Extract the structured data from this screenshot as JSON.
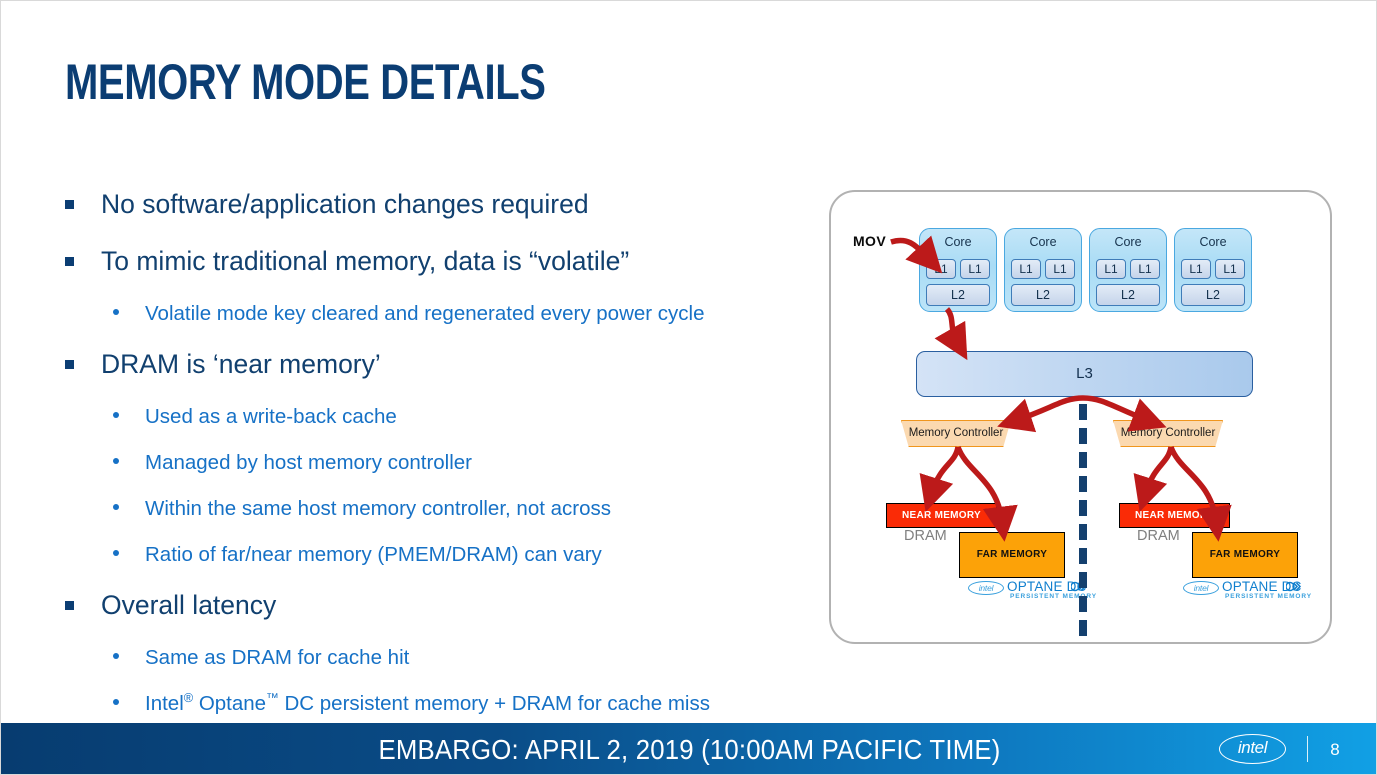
{
  "slide": {
    "title": "MEMORY MODE DETAILS",
    "title_color": "#0b3d73",
    "background": "#ffffff"
  },
  "bullets": [
    {
      "level": 1,
      "text": "No software/application changes required"
    },
    {
      "level": 1,
      "text": "To mimic traditional memory, data is “volatile”"
    },
    {
      "level": 2,
      "text": "Volatile mode key cleared and regenerated every power cycle"
    },
    {
      "level": 1,
      "text": "DRAM is ‘near memory’"
    },
    {
      "level": 2,
      "text": "Used as a write-back cache"
    },
    {
      "level": 2,
      "text": "Managed by host memory controller"
    },
    {
      "level": 2,
      "text": "Within the same host memory controller, not across"
    },
    {
      "level": 2,
      "text": "Ratio of far/near memory (PMEM/DRAM) can vary"
    },
    {
      "level": 1,
      "text": "Overall latency"
    },
    {
      "level": 2,
      "text": "Same as DRAM for cache hit"
    },
    {
      "level": 2,
      "text": "Intel® Optane™ DC persistent memory + DRAM for cache miss"
    }
  ],
  "bullet_colors": {
    "level1_text": "#11406f",
    "level2_text": "#1671c6",
    "level1_marker": "#0b3d73",
    "level2_marker": "#1671c6"
  },
  "diagram": {
    "mov_label": "MOV",
    "cores": [
      {
        "title": "Core",
        "l1_left": "L1",
        "l1_right": "L1",
        "l2": "L2"
      },
      {
        "title": "Core",
        "l1_left": "L1",
        "l1_right": "L1",
        "l2": "L2"
      },
      {
        "title": "Core",
        "l1_left": "L1",
        "l1_right": "L1",
        "l2": "L2"
      },
      {
        "title": "Core",
        "l1_left": "L1",
        "l1_right": "L1",
        "l2": "L2"
      }
    ],
    "l3_label": "L3",
    "memory_controllers": [
      {
        "label": "Memory Controller"
      },
      {
        "label": "Memory Controller"
      }
    ],
    "sockets": [
      {
        "near_memory": "NEAR MEMORY",
        "dram": "DRAM",
        "far_memory": "FAR MEMORY",
        "optane_brand": "intel",
        "optane_name": "OPTANE DC",
        "optane_tagline": "PERSISTENT MEMORY"
      },
      {
        "near_memory": "NEAR MEMORY",
        "dram": "DRAM",
        "far_memory": "FAR MEMORY",
        "optane_brand": "intel",
        "optane_name": "OPTANE DC",
        "optane_tagline": "PERSISTENT MEMORY"
      }
    ],
    "colors": {
      "arrow": "#bc1a1a",
      "core_fill": "#aadcf5",
      "core_border": "#4aa8e0",
      "l3_border": "#2a5fa0",
      "mc_fill": "#fbd9b0",
      "mc_border": "#f0961e",
      "near_memory_fill": "#fa2b06",
      "far_memory_fill": "#fca208",
      "divider": "#14406e",
      "container_border": "#b2b2b2",
      "dram_text": "#7f7f7f",
      "optane_blue": "#0f7fce"
    }
  },
  "footer": {
    "text": "EMBARGO: APRIL 2, 2019 (10:00AM PACIFIC TIME)",
    "brand": "intel",
    "page_number": "8",
    "gradient_from": "#073c70",
    "gradient_to": "#11a0e5"
  }
}
